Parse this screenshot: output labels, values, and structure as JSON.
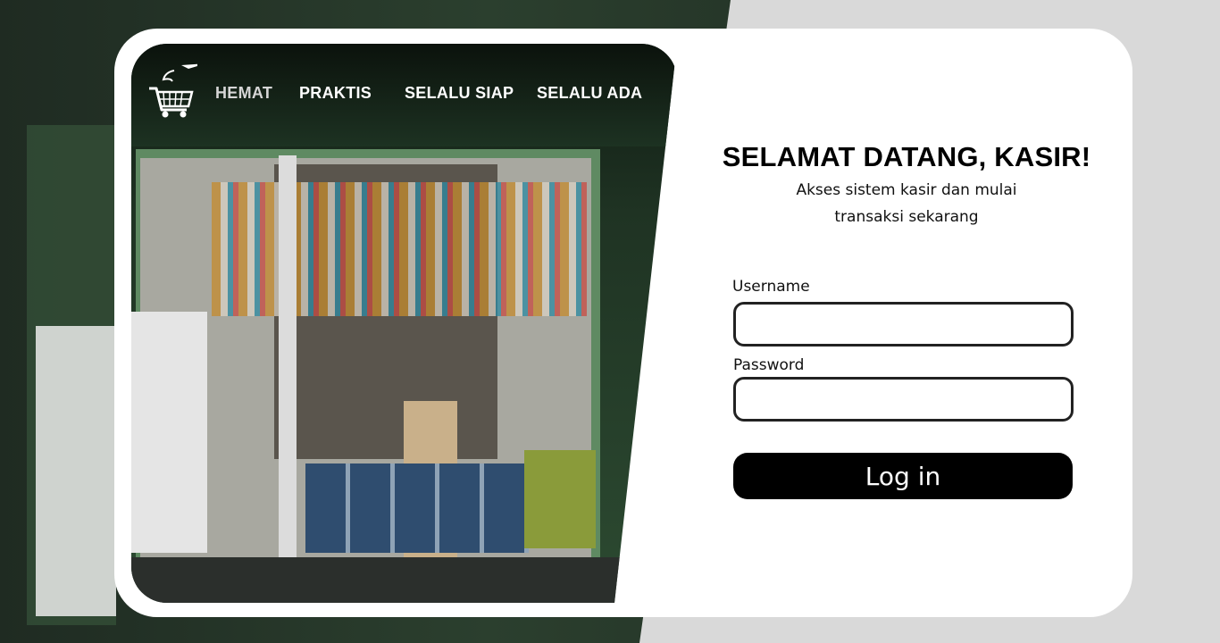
{
  "nav": {
    "items": [
      {
        "label": "HEMAT"
      },
      {
        "label": "PRAKTIS"
      },
      {
        "label": "SELALU SIAP"
      },
      {
        "label": "SELALU ADA"
      }
    ],
    "logo_icon": "shopping-cart-icon"
  },
  "login": {
    "title": "SELAMAT DATANG, KASIR!",
    "subtitle": "Akses sistem kasir dan mulai transaksi sekarang",
    "username_label": "Username",
    "username_value": "",
    "password_label": "Password",
    "password_value": "",
    "submit_label": "Log in"
  },
  "colors": {
    "card_bg": "#ffffff",
    "page_bg": "#d9d9d9",
    "button_bg": "#000000",
    "button_text": "#ffffff",
    "field_border": "#222222"
  }
}
